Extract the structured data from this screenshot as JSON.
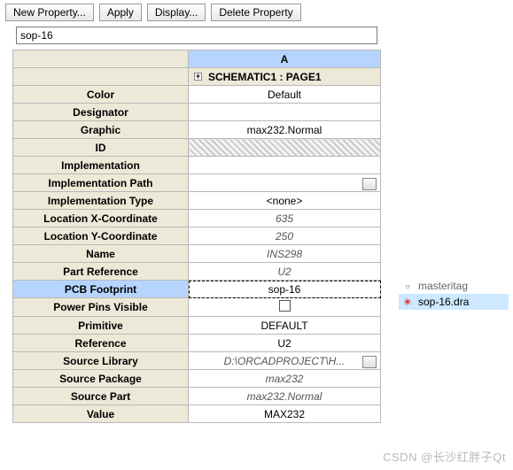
{
  "toolbar": {
    "new_property": "New Property...",
    "apply": "Apply",
    "display": "Display...",
    "delete_property": "Delete Property"
  },
  "input": {
    "value": "sop-16"
  },
  "sheet": {
    "col_header": "A",
    "group_header": "SCHEMATIC1 : PAGE1",
    "rows": [
      {
        "label": "Color",
        "value": "Default",
        "cls": ""
      },
      {
        "label": "Designator",
        "value": "",
        "cls": ""
      },
      {
        "label": "Graphic",
        "value": "max232.Normal",
        "cls": ""
      },
      {
        "label": "ID",
        "value": "",
        "cls": "hatch"
      },
      {
        "label": "Implementation",
        "value": "",
        "cls": ""
      },
      {
        "label": "Implementation Path",
        "value": "",
        "cls": "tiny-btn rel"
      },
      {
        "label": "Implementation Type",
        "value": "<none>",
        "cls": ""
      },
      {
        "label": "Location X-Coordinate",
        "value": "635",
        "cls": "ital"
      },
      {
        "label": "Location Y-Coordinate",
        "value": "250",
        "cls": "ital"
      },
      {
        "label": "Name",
        "value": "INS298",
        "cls": "ital"
      },
      {
        "label": "Part Reference",
        "value": "U2",
        "cls": "ital"
      },
      {
        "label": "PCB Footprint",
        "value": "sop-16",
        "cls": "sel-cell",
        "sel": true
      },
      {
        "label": "Power Pins Visible",
        "value": "",
        "cls": "chk"
      },
      {
        "label": "Primitive",
        "value": "DEFAULT",
        "cls": ""
      },
      {
        "label": "Reference",
        "value": "U2",
        "cls": ""
      },
      {
        "label": "Source Library",
        "value": "D:\\ORCADPROJECT\\H...",
        "cls": "ital tiny-btn rel"
      },
      {
        "label": "Source Package",
        "value": "max232",
        "cls": "ital"
      },
      {
        "label": "Source Part",
        "value": "max232.Normal",
        "cls": "ital"
      },
      {
        "label": "Value",
        "value": "MAX232",
        "cls": ""
      }
    ]
  },
  "files": [
    {
      "name": "masteritag",
      "icon": "▫",
      "sel": false
    },
    {
      "name": "sop-16.dra",
      "icon": "✴",
      "sel": true
    }
  ],
  "watermark": "CSDN @长沙红胖子Qt"
}
